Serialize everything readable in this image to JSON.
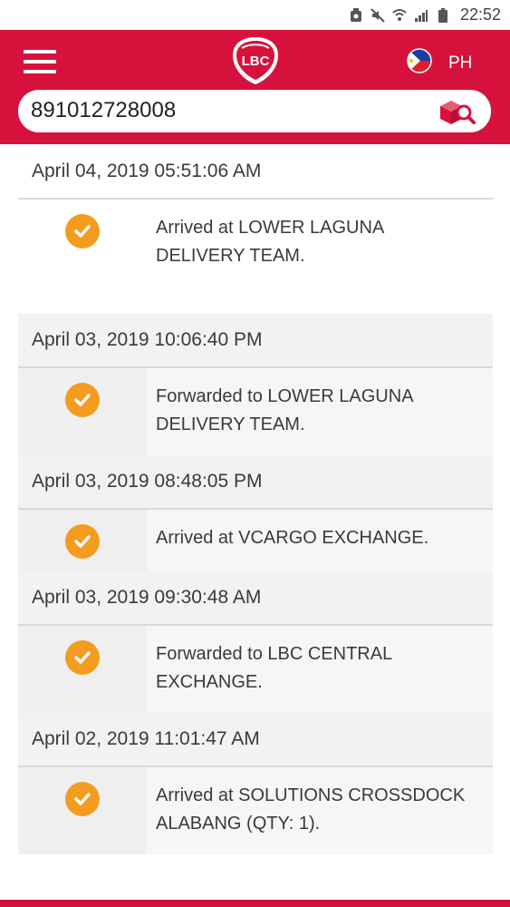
{
  "status_bar": {
    "time": "22:52",
    "icons": [
      "battery-saver-icon",
      "mute-icon",
      "wifi-icon",
      "signal-icon",
      "battery-icon"
    ]
  },
  "header": {
    "logo_text": "LBC",
    "menu_icon": "hamburger-menu-icon",
    "country_flag": "philippines-flag-icon",
    "country_code": "PH"
  },
  "search": {
    "value": "891012728008",
    "search_icon": "parcel-search-icon"
  },
  "colors": {
    "brand_red": "#d6123c",
    "check_orange": "#f39c1f"
  },
  "tracking": {
    "entries": [
      {
        "datetime": "April 04, 2019 05:51:06 AM",
        "status": "Arrived at LOWER LAGUNA DELIVERY TEAM.",
        "icon": "check-circle-icon"
      },
      {
        "datetime": "April 03, 2019 10:06:40 PM",
        "status": "Forwarded to LOWER LAGUNA DELIVERY TEAM.",
        "icon": "check-circle-icon"
      },
      {
        "datetime": "April 03, 2019 08:48:05 PM",
        "status": "Arrived at VCARGO EXCHANGE.",
        "icon": "check-circle-icon"
      },
      {
        "datetime": "April 03, 2019 09:30:48 AM",
        "status": "Forwarded to LBC CENTRAL EXCHANGE.",
        "icon": "check-circle-icon"
      },
      {
        "datetime": "April 02, 2019 11:01:47 AM",
        "status": "Arrived at SOLUTIONS CROSSDOCK ALABANG (QTY: 1).",
        "icon": "check-circle-icon"
      }
    ]
  }
}
